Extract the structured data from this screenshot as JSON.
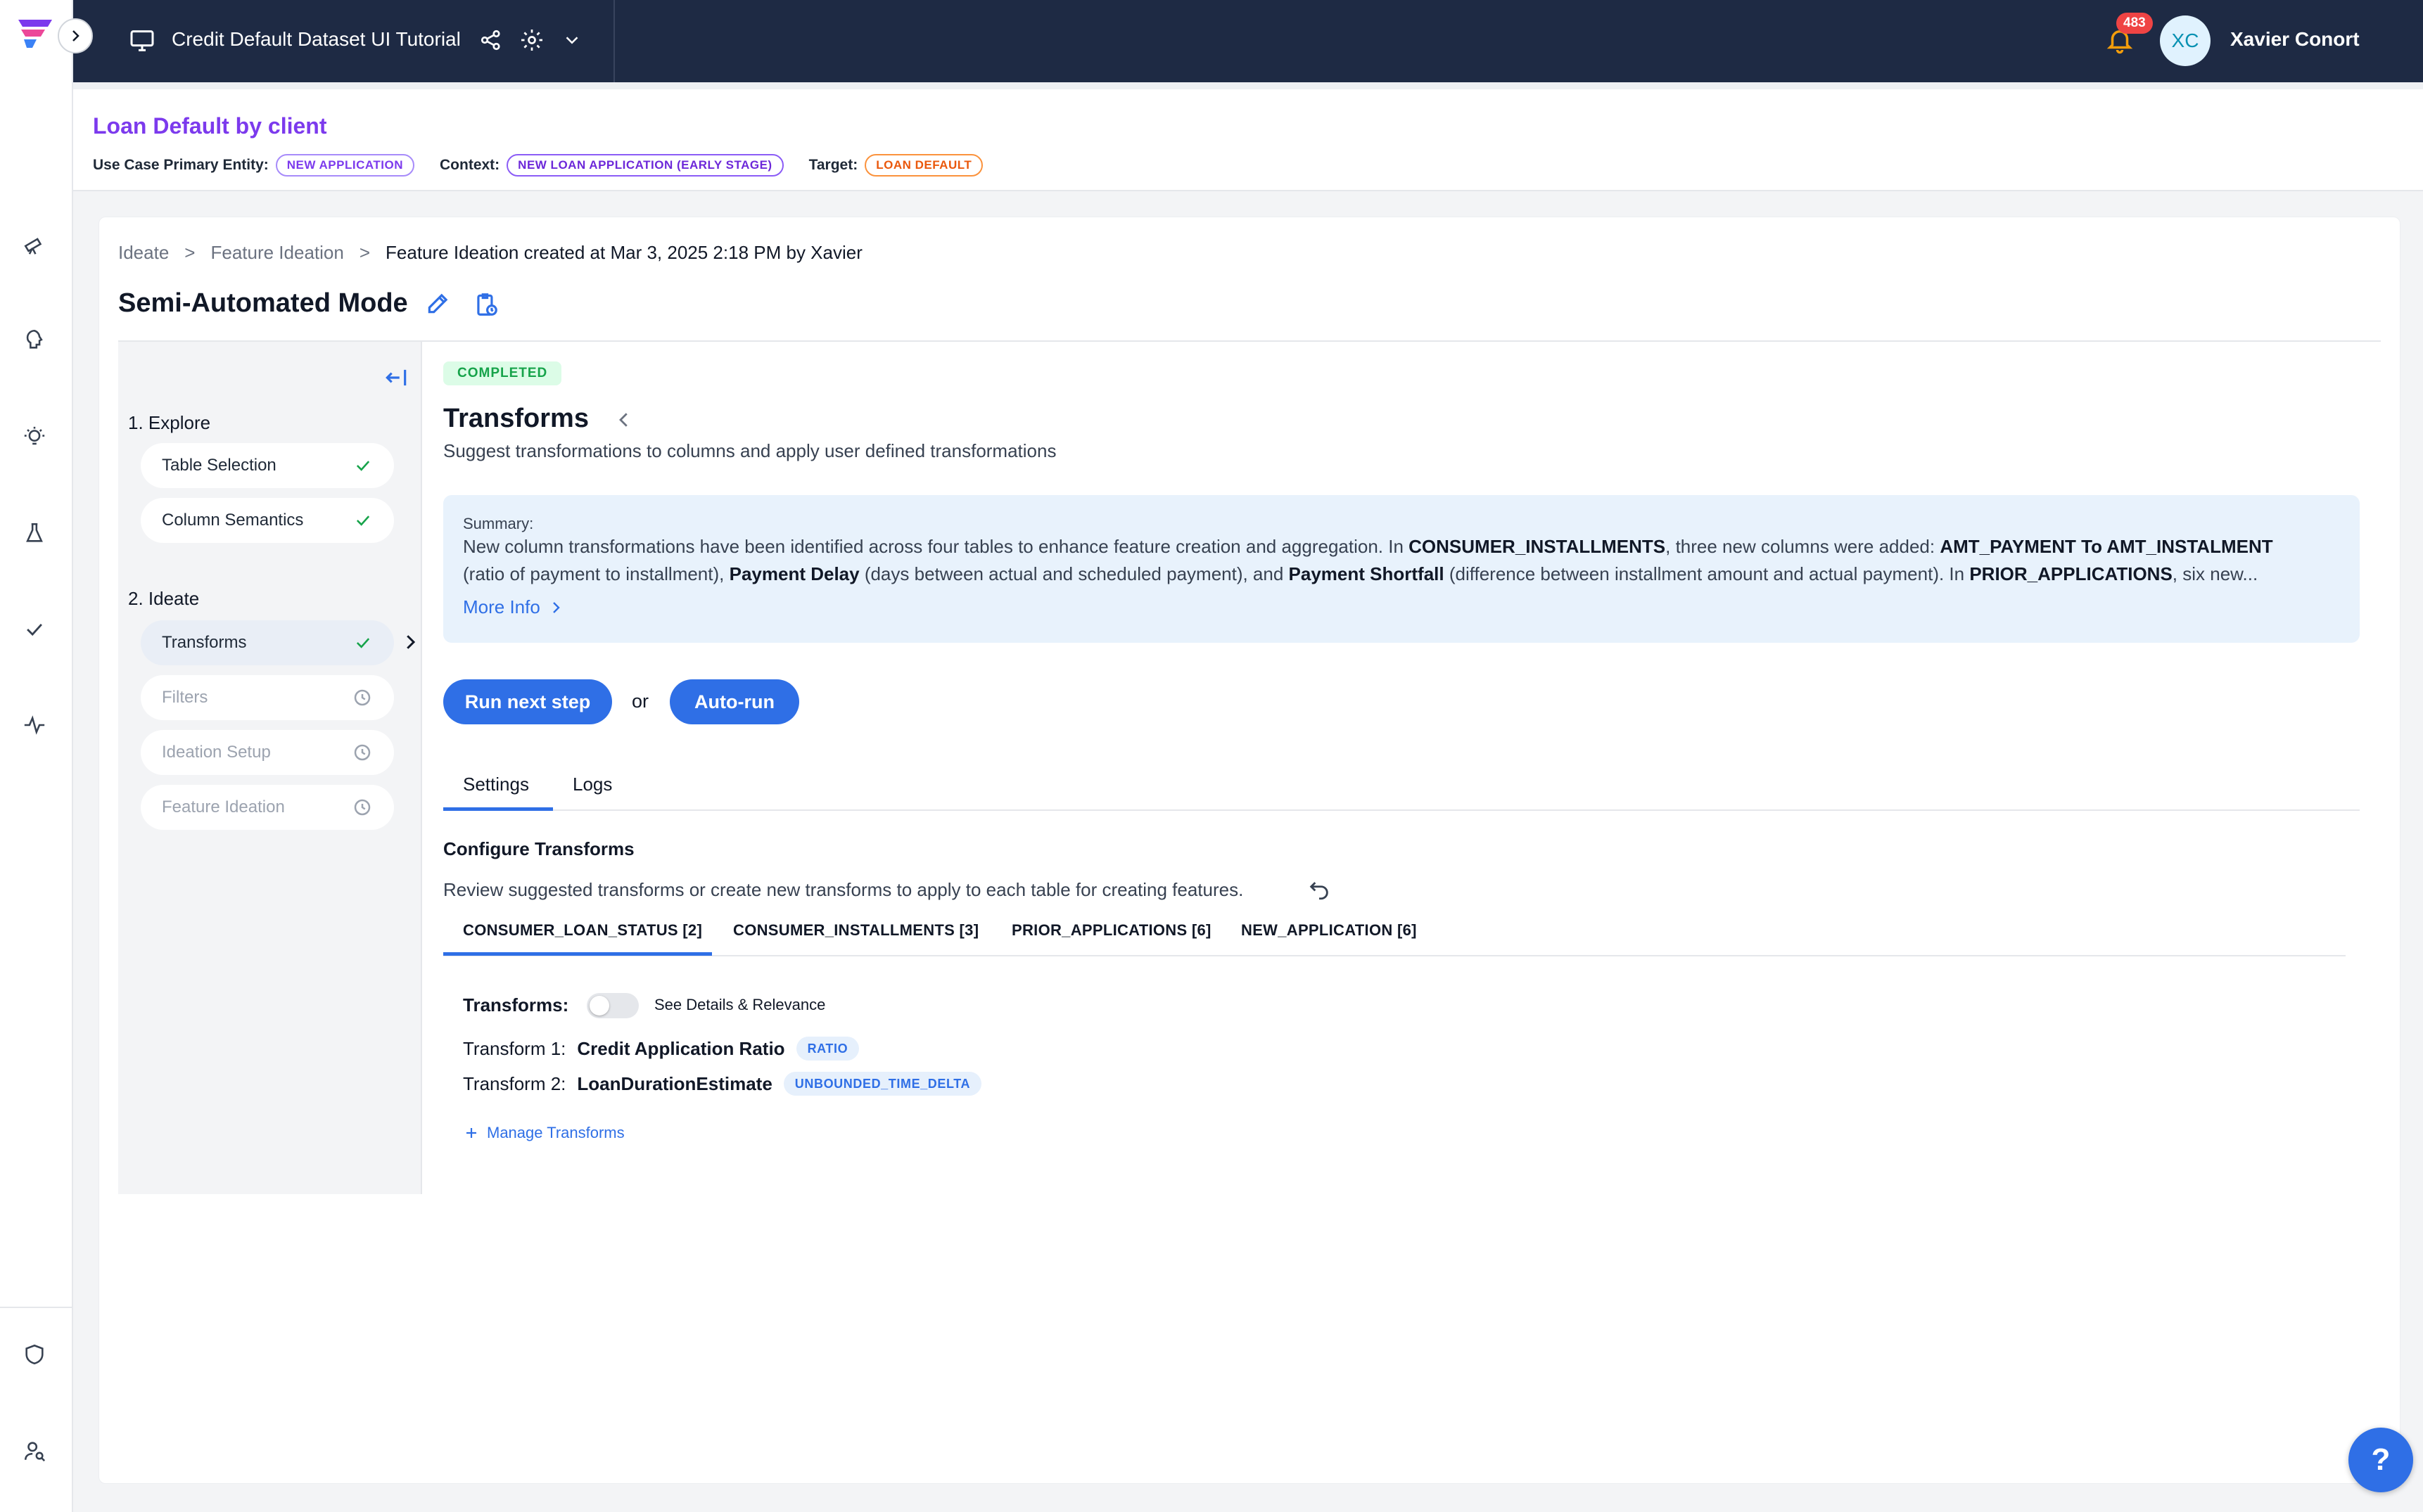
{
  "topbar": {
    "project_title": "Credit Default Dataset UI Tutorial",
    "notification_count": "483",
    "user_initials": "XC",
    "user_name": "Xavier Conort"
  },
  "header": {
    "use_case_title": "Loan Default by client",
    "entity_label": "Use Case Primary Entity:",
    "entity_value": "NEW APPLICATION",
    "context_label": "Context:",
    "context_value": "NEW LOAN APPLICATION (EARLY STAGE)",
    "target_label": "Target:",
    "target_value": "LOAN DEFAULT"
  },
  "breadcrumb": {
    "items": [
      "Ideate",
      "Feature Ideation",
      "Feature Ideation created at Mar 3, 2025 2:18 PM by Xavier"
    ],
    "separator": ">"
  },
  "page_title": "Semi-Automated Mode",
  "steps": {
    "section1": "1. Explore",
    "section2": "2. Ideate",
    "items": [
      {
        "label": "Table Selection",
        "status": "done"
      },
      {
        "label": "Column Semantics",
        "status": "done"
      },
      {
        "label": "Transforms",
        "status": "done"
      },
      {
        "label": "Filters",
        "status": "pending"
      },
      {
        "label": "Ideation Setup",
        "status": "pending"
      },
      {
        "label": "Feature Ideation",
        "status": "pending"
      }
    ]
  },
  "content": {
    "status_badge": "COMPLETED",
    "title": "Transforms",
    "subtitle": "Suggest transformations to columns and apply user defined transformations",
    "summary_label": "Summary:",
    "summary_line1_parts": [
      "New column transformations have been identified across four tables to enhance feature creation and aggregation. In ",
      "CONSUMER_INSTALLMENTS",
      ", three new columns were added: ",
      "AMT_PAYMENT To AMT_INSTALMENT"
    ],
    "summary_line2_parts": [
      "(ratio of payment to installment), ",
      "Payment Delay",
      " (days between actual and scheduled payment), and ",
      "Payment Shortfall",
      " (difference between installment amount and actual payment). In ",
      "PRIOR_APPLICATIONS",
      ", six new..."
    ],
    "more_info": "More Info",
    "run_next": "Run next step",
    "or": "or",
    "auto_run": "Auto-run",
    "tabs": [
      "Settings",
      "Logs"
    ],
    "configure_title": "Configure Transforms",
    "configure_desc": "Review suggested transforms or create new transforms to apply to each table for creating features.",
    "table_tabs": [
      "CONSUMER_LOAN_STATUS [2]",
      "CONSUMER_INSTALLMENTS [3]",
      "PRIOR_APPLICATIONS [6]",
      "NEW_APPLICATION [6]"
    ],
    "transforms_label": "Transforms:",
    "toggle_label": "See Details & Relevance",
    "transforms": [
      {
        "prefix": "Transform 1:",
        "name": "Credit Application Ratio",
        "type": "RATIO"
      },
      {
        "prefix": "Transform 2:",
        "name": "LoanDurationEstimate",
        "type": "UNBOUNDED_TIME_DELTA"
      }
    ],
    "manage": "Manage Transforms"
  },
  "help_button": "?",
  "colors": {
    "topbar": "#1e2a44",
    "accent": "#2f6fe6",
    "purple": "#7c3aed",
    "success": "#16a34a",
    "orange": "#ea580c",
    "summary_bg": "#e8f2fc"
  }
}
